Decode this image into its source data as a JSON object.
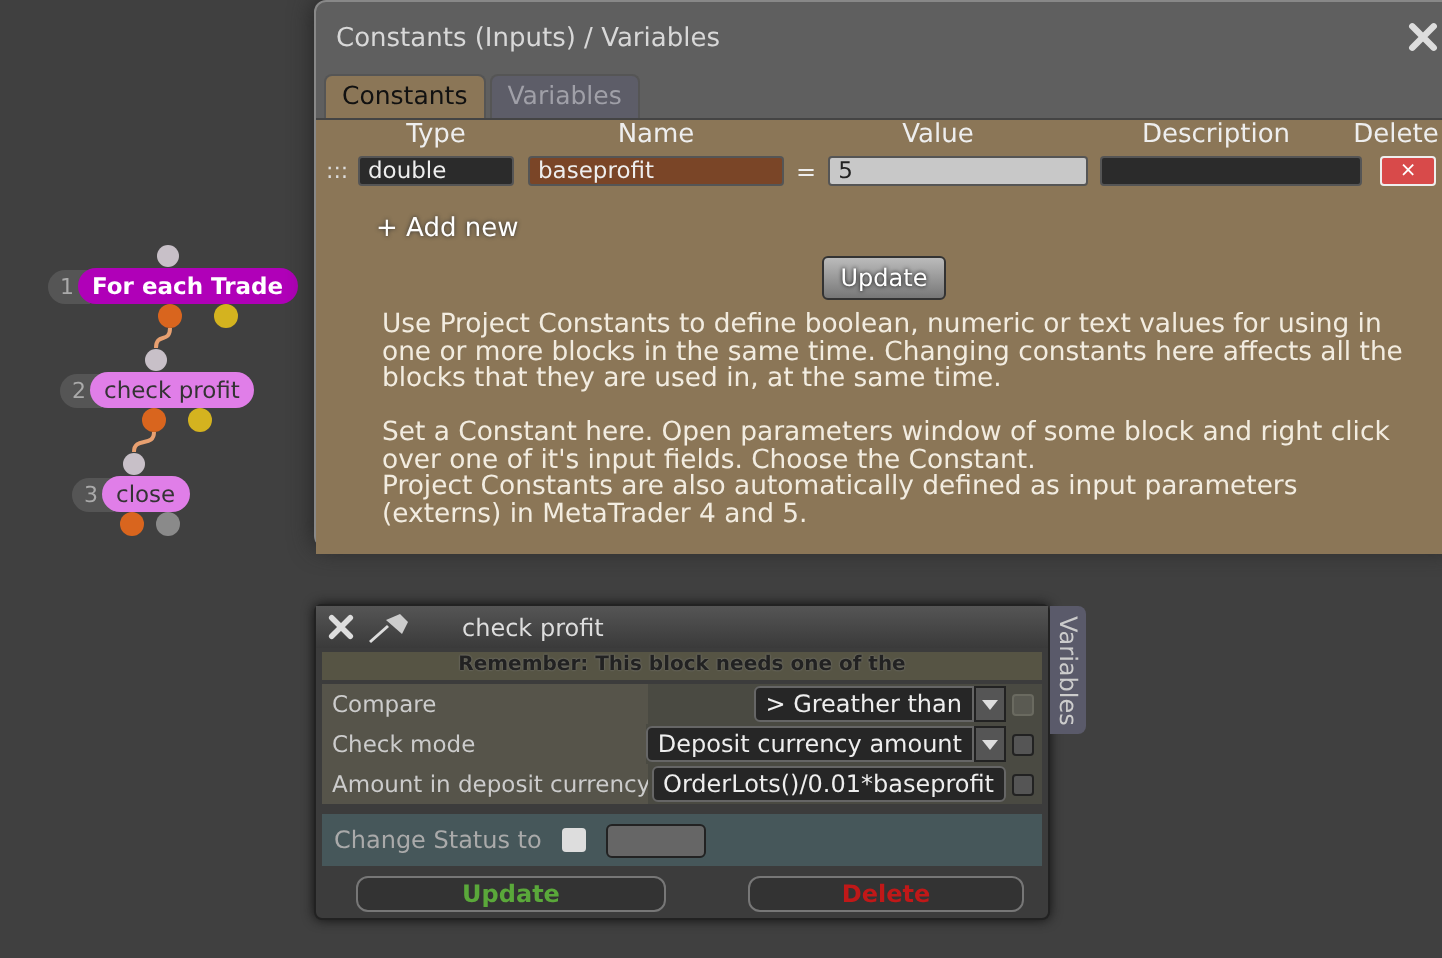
{
  "blocks": [
    {
      "number": "1",
      "label": "For each Trade",
      "color": "#b000b8",
      "kind": "branch"
    },
    {
      "number": "2",
      "label": "check profit",
      "color": "#e07ee8",
      "kind": "branch"
    },
    {
      "number": "3",
      "label": "close",
      "color": "#e07ee8",
      "kind": "action"
    }
  ],
  "constants_window": {
    "title": "Constants (Inputs) / Variables",
    "tabs": [
      {
        "label": "Constants",
        "selected": true
      },
      {
        "label": "Variables",
        "selected": false
      }
    ],
    "columns": [
      "Type",
      "Name",
      "Value",
      "Description",
      "Delete"
    ],
    "rows": [
      {
        "handle": ":::",
        "type": "double",
        "name": "baseprofit",
        "equals": "=",
        "value": "5",
        "description": "",
        "delete": "×"
      }
    ],
    "add_new": "+ Add new",
    "update": "Update",
    "help": [
      "Use Project Constants to define boolean, numeric or text values for using in one or more blocks in the same time. Changing constants here affects all the blocks that they are used in, at the same time.",
      "Set a Constant here. Open parameters window of some block and right click over one of it's input fields. Choose the Constant.",
      "Project Constants are also automatically defined as input parameters (externs) in MetaTrader 4 and 5."
    ]
  },
  "block_window": {
    "title": "check profit",
    "side_tab": "Variables",
    "note": "Remember: This block needs one of the",
    "params": [
      {
        "label": "Compare",
        "kind": "select",
        "value": "> Greather than",
        "checked": false,
        "disabled": true
      },
      {
        "label": "Check mode",
        "kind": "select",
        "value": "Deposit currency amount",
        "checked": false,
        "disabled": false
      },
      {
        "label": "Amount in deposit currency",
        "kind": "input",
        "value": "OrderLots()/0.01*baseprofit",
        "checked": false,
        "disabled": false
      }
    ],
    "status_label": "Change Status to",
    "status_checked": false,
    "buttons": [
      {
        "label": "Update",
        "kind": "update"
      },
      {
        "label": "Delete",
        "kind": "delete"
      }
    ]
  }
}
